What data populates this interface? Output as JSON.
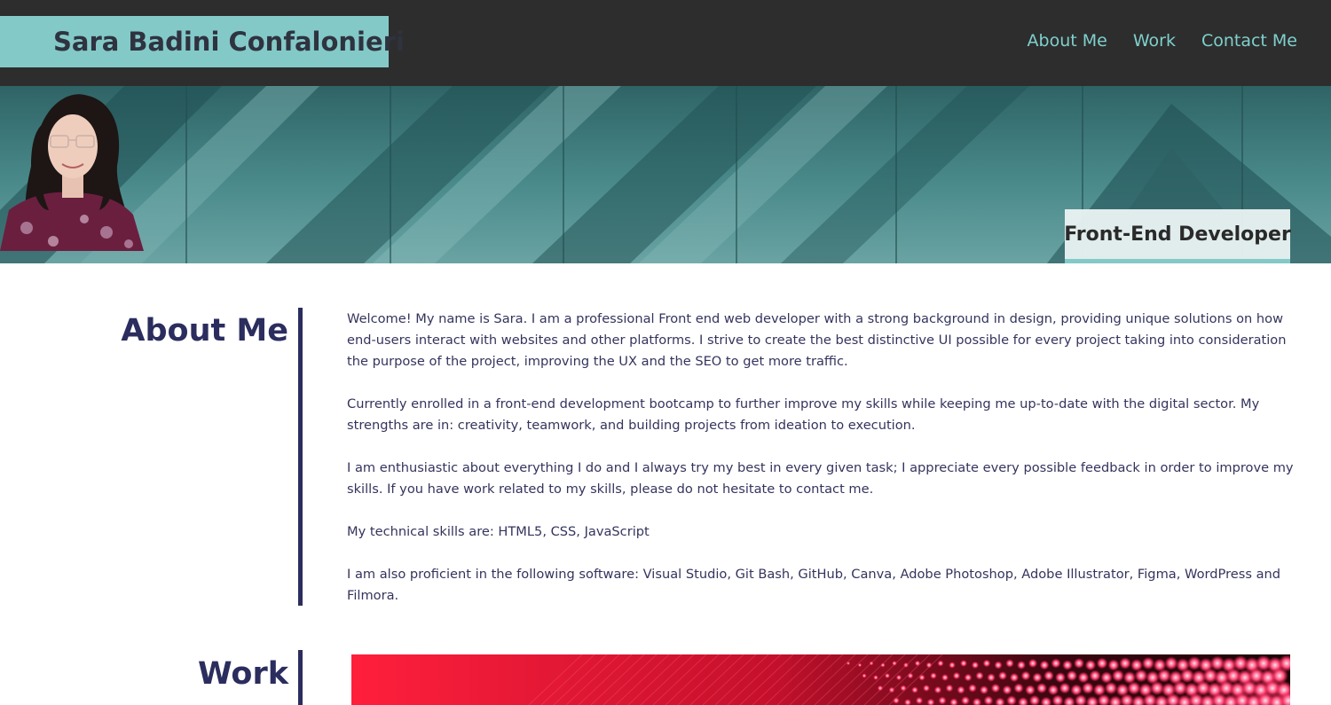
{
  "header": {
    "site_name": "Sara Badini Confalonieri",
    "nav": [
      {
        "label": "About Me"
      },
      {
        "label": "Work"
      },
      {
        "label": "Contact Me"
      }
    ]
  },
  "hero": {
    "role": "Front-End Developer",
    "photo_icon": "profile-photo"
  },
  "about": {
    "title": "About Me",
    "paragraphs": [
      "Welcome! My name is Sara. I am a professional Front end web developer with a strong background in design, providing unique solutions on how end-users interact with websites and other platforms. I strive to create the best distinctive UI possible for every project taking into consideration the purpose of the project, improving the UX and the SEO to get more traffic.",
      "Currently enrolled in a front-end development bootcamp to further improve my skills while keeping me up-to-date with the digital sector. My strengths are in: creativity, teamwork, and building projects from ideation to execution.",
      "I am enthusiastic about everything I do and I always try my best in every given task; I appreciate every possible feedback in order to improve my skills. If you have work related to my skills, please do not hesitate to contact me.",
      "My technical skills are: HTML5, CSS, JavaScript",
      "I am also proficient in the following software: Visual Studio, Git Bash, GitHub, Canva, Adobe Photoshop, Adobe Illustrator, Figma, WordPress and Filmora."
    ]
  },
  "work": {
    "title": "Work"
  },
  "colors": {
    "header_bg": "#2d2d2d",
    "accent": "#83c9c8",
    "nav_text": "#7fd0cd",
    "heading": "#2b2d5e"
  }
}
